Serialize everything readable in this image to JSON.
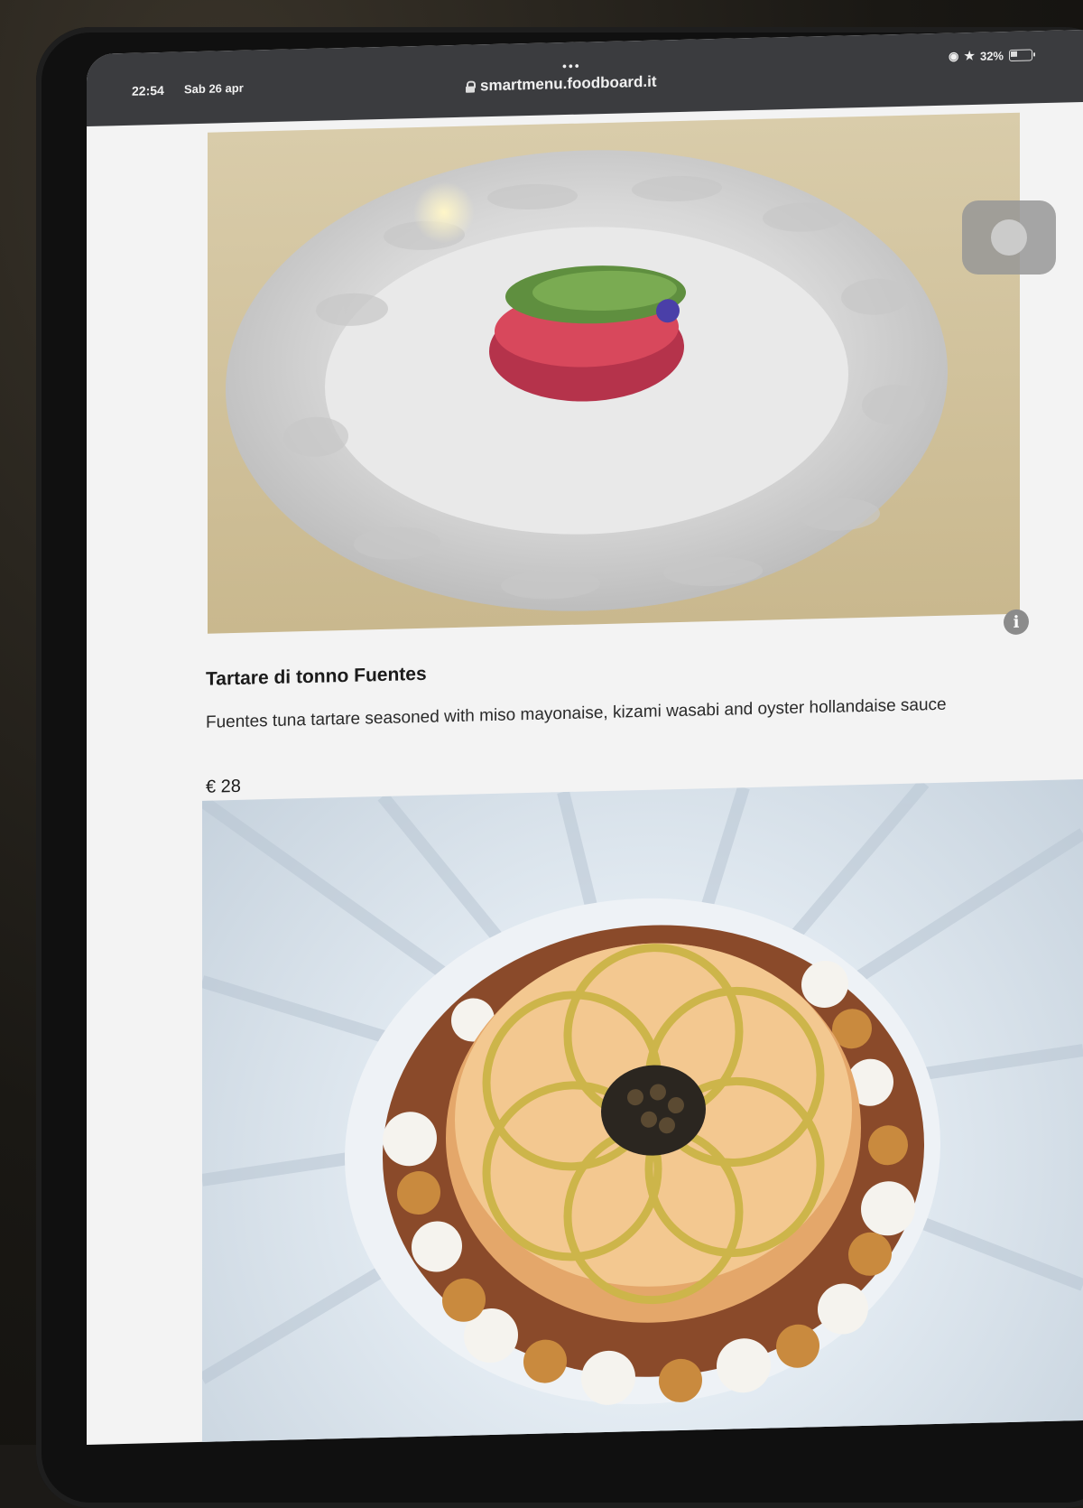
{
  "status": {
    "time": "22:54",
    "date": "Sab 26 apr",
    "url": "smartmenu.foodboard.it",
    "battery": "32%"
  },
  "menu": {
    "items": [
      {
        "name": "Tartare di tonno Fuentes",
        "description": "Fuentes tuna tartare seasoned with miso mayonaise, kizami wasabi and oyster hollandaise sauce",
        "price": "€ 28"
      }
    ]
  },
  "icons": {
    "info": "i"
  },
  "colors": {
    "statusbar": "#3b3c3f",
    "page_bg": "#f3f3f3"
  }
}
